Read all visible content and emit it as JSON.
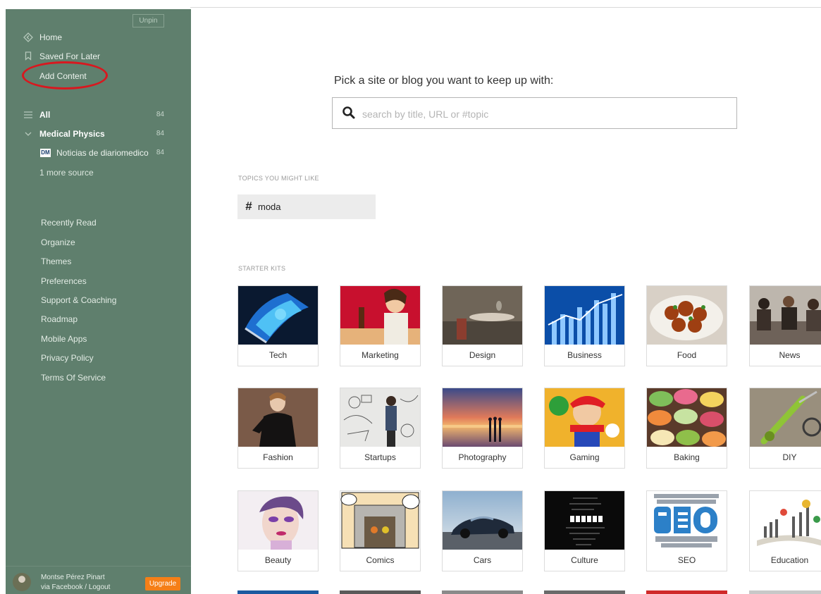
{
  "sidebar": {
    "unpin_label": "Unpin",
    "primary_nav": [
      {
        "label": "Home",
        "icon": "home-icon"
      },
      {
        "label": "Saved For Later",
        "icon": "bookmark-icon"
      },
      {
        "label": "Add Content",
        "icon": ""
      }
    ],
    "feeds": {
      "all": {
        "label": "All",
        "count": "84",
        "icon": "list-icon"
      },
      "category": {
        "label": "Medical Physics",
        "count": "84",
        "icon": "chevron-down-icon"
      },
      "source": {
        "label": "Noticias de diariomedico",
        "count": "84",
        "badge": "DM"
      },
      "more": "1 more source"
    },
    "menu_links": [
      "Recently Read",
      "Organize",
      "Themes",
      "Preferences",
      "Support & Coaching",
      "Roadmap",
      "Mobile Apps",
      "Privacy Policy",
      "Terms Of Service"
    ],
    "user": {
      "name": "Montse Pérez Pinart",
      "sub": "via Facebook / Logout",
      "upgrade_label": "Upgrade"
    },
    "colors": {
      "background": "#5f7f6d",
      "upgrade": "#f57f17",
      "annotation": "#d8181f"
    }
  },
  "main": {
    "prompt": "Pick a site or blog you want to keep up with:",
    "search": {
      "placeholder": "search by title, URL or #topic",
      "value": ""
    },
    "topics_heading": "TOPICS YOU MIGHT LIKE",
    "topics": [
      {
        "symbol": "#",
        "label": "moda"
      }
    ],
    "starter_heading": "STARTER KITS",
    "starter_kits": [
      "Tech",
      "Marketing",
      "Design",
      "Business",
      "Food",
      "News",
      "Fashion",
      "Startups",
      "Photography",
      "Gaming",
      "Baking",
      "DIY",
      "Beauty",
      "Comics",
      "Cars",
      "Culture",
      "SEO",
      "Education"
    ]
  }
}
